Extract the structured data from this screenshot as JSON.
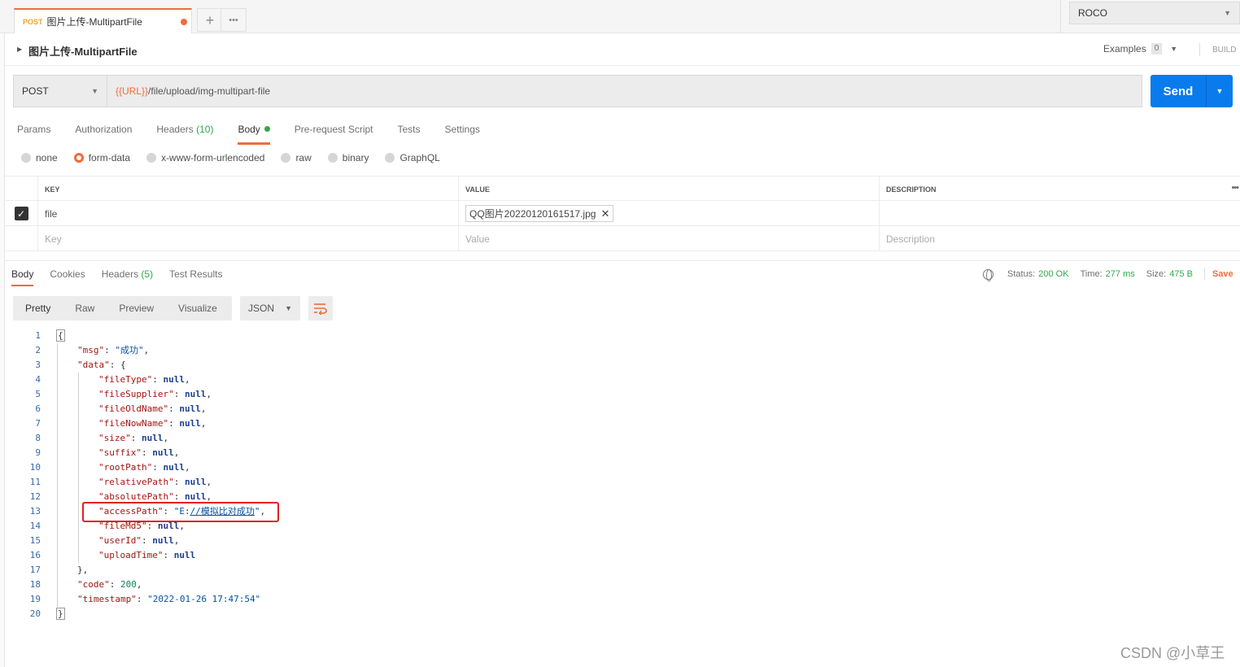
{
  "request_tab": {
    "method": "POST",
    "name": "图片上传-MultipartFile"
  },
  "environment": "ROCO",
  "request_title": "图片上传-MultipartFile",
  "examples": {
    "label": "Examples",
    "count": "0"
  },
  "build_label": "BUILD",
  "method": "POST",
  "url": {
    "variable": "{{URL}}",
    "path": "/file/upload/img-multipart-file"
  },
  "send_label": "Send",
  "request_tabs": {
    "params": "Params",
    "authorization": "Authorization",
    "headers": "Headers",
    "headers_count": "(10)",
    "body": "Body",
    "prerequest": "Pre-request Script",
    "tests": "Tests",
    "settings": "Settings"
  },
  "body_types": [
    "none",
    "form-data",
    "x-www-form-urlencoded",
    "raw",
    "binary",
    "GraphQL"
  ],
  "form_table": {
    "headers": {
      "key": "KEY",
      "value": "VALUE",
      "description": "DESCRIPTION"
    },
    "row": {
      "key": "file",
      "value": "QQ图片20220120161517.jpg"
    },
    "placeholders": {
      "key": "Key",
      "value": "Value",
      "description": "Description"
    }
  },
  "response_tabs": {
    "body": "Body",
    "cookies": "Cookies",
    "headers": "Headers",
    "headers_count": "(5)",
    "test_results": "Test Results"
  },
  "response_status": {
    "status_label": "Status:",
    "status": "200 OK",
    "time_label": "Time:",
    "time": "277 ms",
    "size_label": "Size:",
    "size": "475 B",
    "save": "Save"
  },
  "view_modes": [
    "Pretty",
    "Raw",
    "Preview",
    "Visualize"
  ],
  "format": "JSON",
  "code_lines": [
    {
      "n": "1",
      "i": 0,
      "t": [
        [
          "p",
          "{"
        ]
      ]
    },
    {
      "n": "2",
      "i": 1,
      "t": [
        [
          "k",
          "\"msg\""
        ],
        [
          "p",
          ": "
        ],
        [
          "s",
          "\"成功\""
        ],
        [
          "p",
          ","
        ]
      ]
    },
    {
      "n": "3",
      "i": 1,
      "t": [
        [
          "k",
          "\"data\""
        ],
        [
          "p",
          ": {"
        ]
      ]
    },
    {
      "n": "4",
      "i": 2,
      "t": [
        [
          "k",
          "\"fileType\""
        ],
        [
          "p",
          ": "
        ],
        [
          "nl",
          "null"
        ],
        [
          "p",
          ","
        ]
      ]
    },
    {
      "n": "5",
      "i": 2,
      "t": [
        [
          "k",
          "\"fileSupplier\""
        ],
        [
          "p",
          ": "
        ],
        [
          "nl",
          "null"
        ],
        [
          "p",
          ","
        ]
      ]
    },
    {
      "n": "6",
      "i": 2,
      "t": [
        [
          "k",
          "\"fileOldName\""
        ],
        [
          "p",
          ": "
        ],
        [
          "nl",
          "null"
        ],
        [
          "p",
          ","
        ]
      ]
    },
    {
      "n": "7",
      "i": 2,
      "t": [
        [
          "k",
          "\"fileNowName\""
        ],
        [
          "p",
          ": "
        ],
        [
          "nl",
          "null"
        ],
        [
          "p",
          ","
        ]
      ]
    },
    {
      "n": "8",
      "i": 2,
      "t": [
        [
          "k",
          "\"size\""
        ],
        [
          "p",
          ": "
        ],
        [
          "nl",
          "null"
        ],
        [
          "p",
          ","
        ]
      ]
    },
    {
      "n": "9",
      "i": 2,
      "t": [
        [
          "k",
          "\"suffix\""
        ],
        [
          "p",
          ": "
        ],
        [
          "nl",
          "null"
        ],
        [
          "p",
          ","
        ]
      ]
    },
    {
      "n": "10",
      "i": 2,
      "t": [
        [
          "k",
          "\"rootPath\""
        ],
        [
          "p",
          ": "
        ],
        [
          "nl",
          "null"
        ],
        [
          "p",
          ","
        ]
      ]
    },
    {
      "n": "11",
      "i": 2,
      "t": [
        [
          "k",
          "\"relativePath\""
        ],
        [
          "p",
          ": "
        ],
        [
          "nl",
          "null"
        ],
        [
          "p",
          ","
        ]
      ]
    },
    {
      "n": "12",
      "i": 2,
      "t": [
        [
          "k",
          "\"absolutePath\""
        ],
        [
          "p",
          ": "
        ],
        [
          "nl",
          "null"
        ],
        [
          "p",
          ","
        ]
      ]
    },
    {
      "n": "13",
      "i": 2,
      "t": [
        [
          "k",
          "\"accessPath\""
        ],
        [
          "p",
          ": "
        ],
        [
          "s",
          "\"E:"
        ],
        [
          "sl",
          "//模拟比对成功"
        ],
        [
          "s",
          "\""
        ],
        [
          "p",
          ","
        ]
      ]
    },
    {
      "n": "14",
      "i": 2,
      "t": [
        [
          "k",
          "\"fileMd5\""
        ],
        [
          "p",
          ": "
        ],
        [
          "nl",
          "null"
        ],
        [
          "p",
          ","
        ]
      ]
    },
    {
      "n": "15",
      "i": 2,
      "t": [
        [
          "k",
          "\"userId\""
        ],
        [
          "p",
          ": "
        ],
        [
          "nl",
          "null"
        ],
        [
          "p",
          ","
        ]
      ]
    },
    {
      "n": "16",
      "i": 2,
      "t": [
        [
          "k",
          "\"uploadTime\""
        ],
        [
          "p",
          ": "
        ],
        [
          "nl",
          "null"
        ]
      ]
    },
    {
      "n": "17",
      "i": 1,
      "t": [
        [
          "p",
          "},"
        ]
      ]
    },
    {
      "n": "18",
      "i": 1,
      "t": [
        [
          "k",
          "\"code\""
        ],
        [
          "p",
          ": "
        ],
        [
          "n",
          "200"
        ],
        [
          "p",
          ","
        ]
      ]
    },
    {
      "n": "19",
      "i": 1,
      "t": [
        [
          "k",
          "\"timestamp\""
        ],
        [
          "p",
          ": "
        ],
        [
          "s",
          "\"2022-01-26 17:47:54\""
        ]
      ]
    },
    {
      "n": "20",
      "i": 0,
      "t": [
        [
          "p",
          "}"
        ]
      ]
    }
  ],
  "watermark": "CSDN @小草王"
}
